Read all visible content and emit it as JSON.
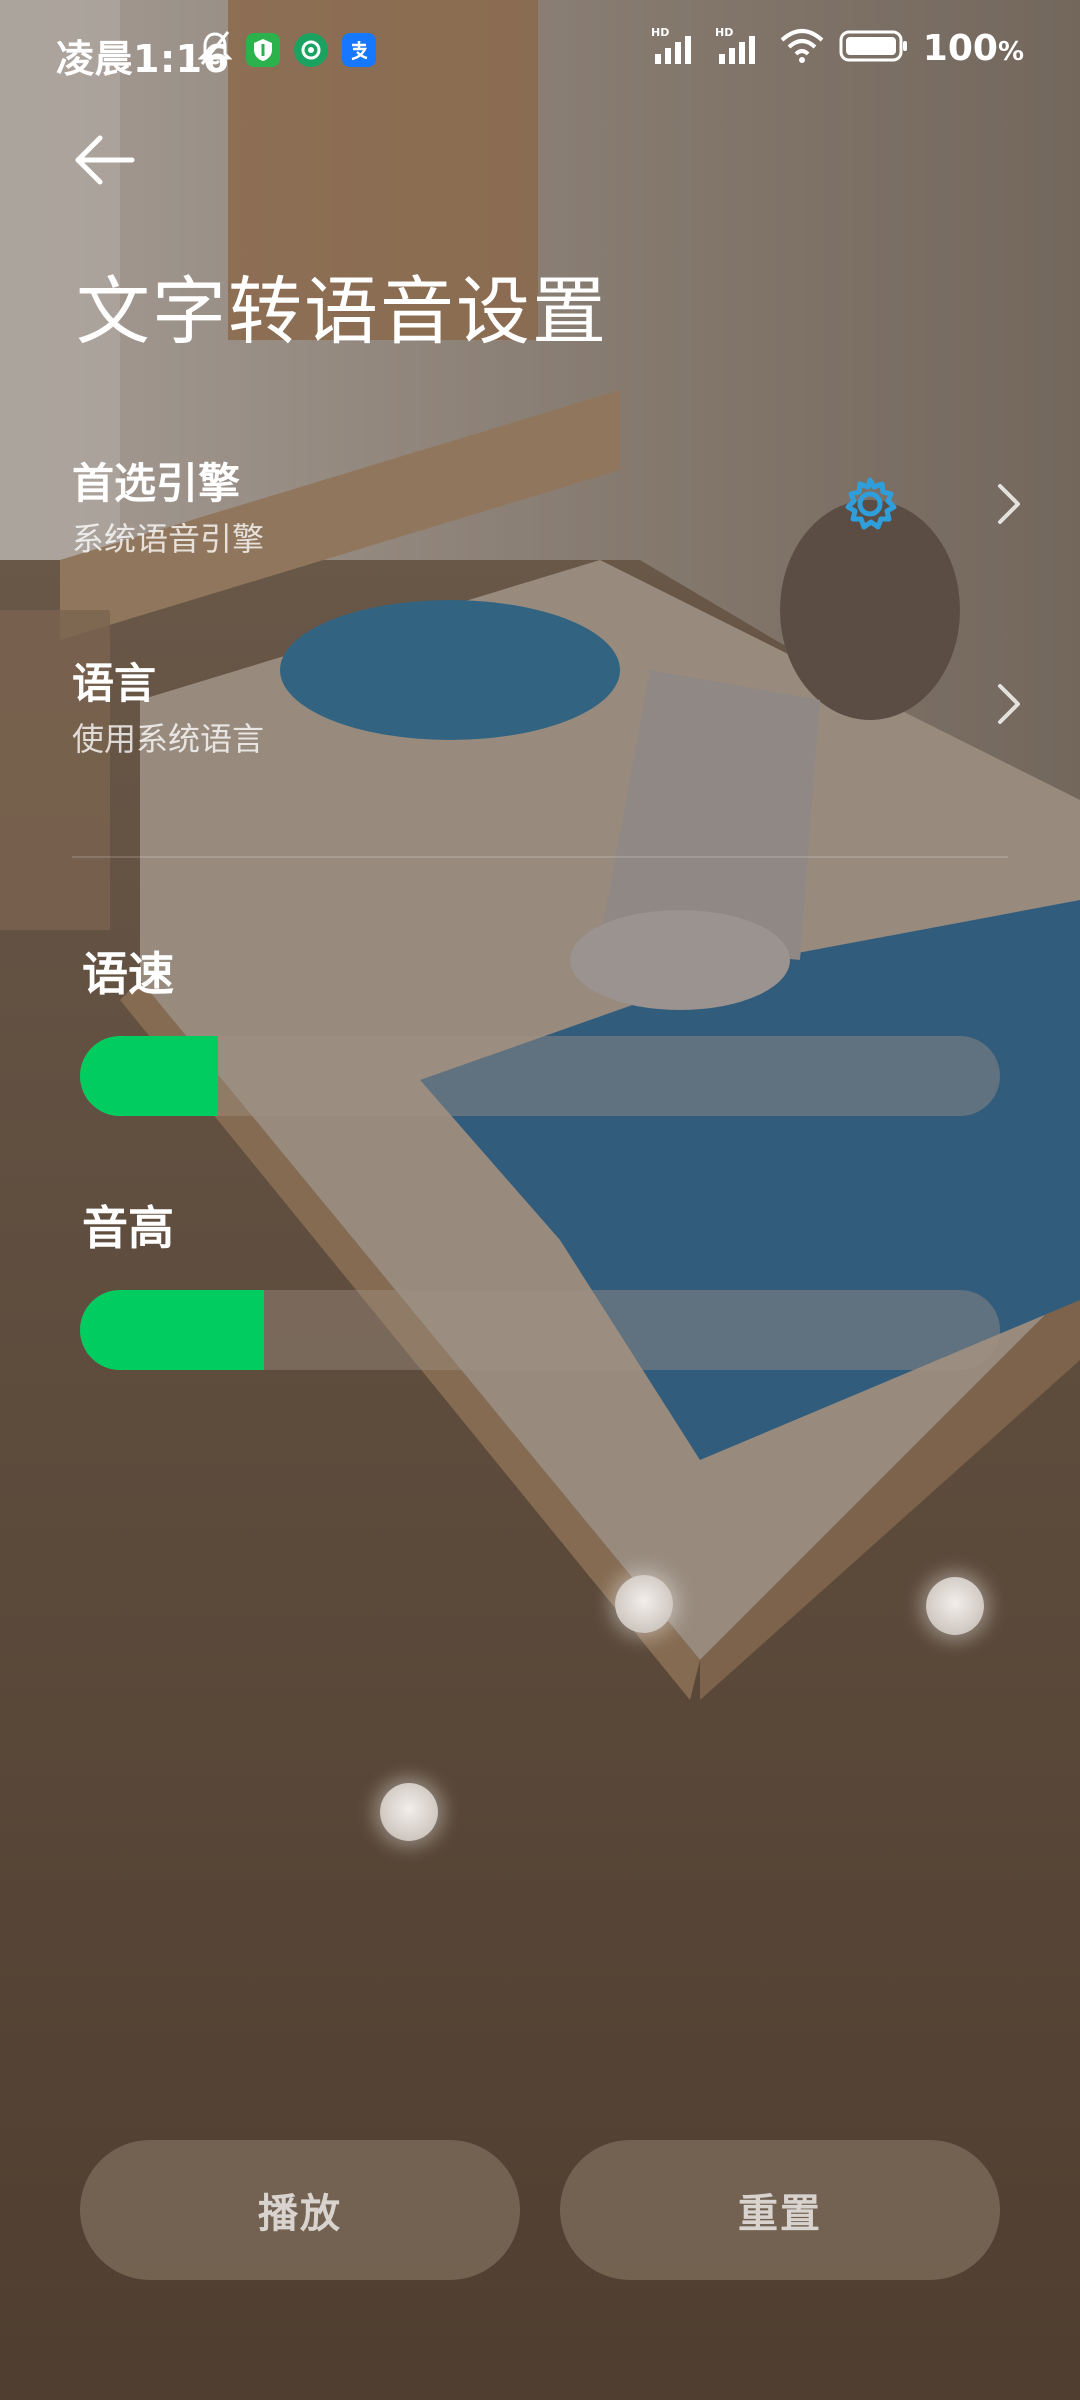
{
  "status_bar": {
    "time": "凌晨1:16",
    "battery": "100",
    "battery_unit": "%",
    "signal_label_1": "HD",
    "signal_label_2": "HD",
    "icons": [
      "mute-bell-icon",
      "shield-app-icon",
      "camera-app-icon",
      "alipay-app-icon",
      "signal-hd-icon",
      "signal-hd-icon",
      "wifi-icon",
      "battery-icon"
    ]
  },
  "header": {
    "back_icon": "arrow-left-icon",
    "title": "文字转语音设置"
  },
  "settings": [
    {
      "title": "首选引擎",
      "subtitle": "系统语音引擎",
      "has_gear": true
    },
    {
      "title": "语言",
      "subtitle": "使用系统语言",
      "has_gear": false
    }
  ],
  "sliders": [
    {
      "label": "语速",
      "value": 0.15
    },
    {
      "label": "音高",
      "value": 0.2
    }
  ],
  "buttons": {
    "play": "播放",
    "reset": "重置"
  },
  "colors": {
    "accent": "#00cc60",
    "gear": "#2f9fdc",
    "shield_app": "#2bb24c",
    "camera_app": "#1aa260",
    "alipay_app": "#1677ff"
  }
}
